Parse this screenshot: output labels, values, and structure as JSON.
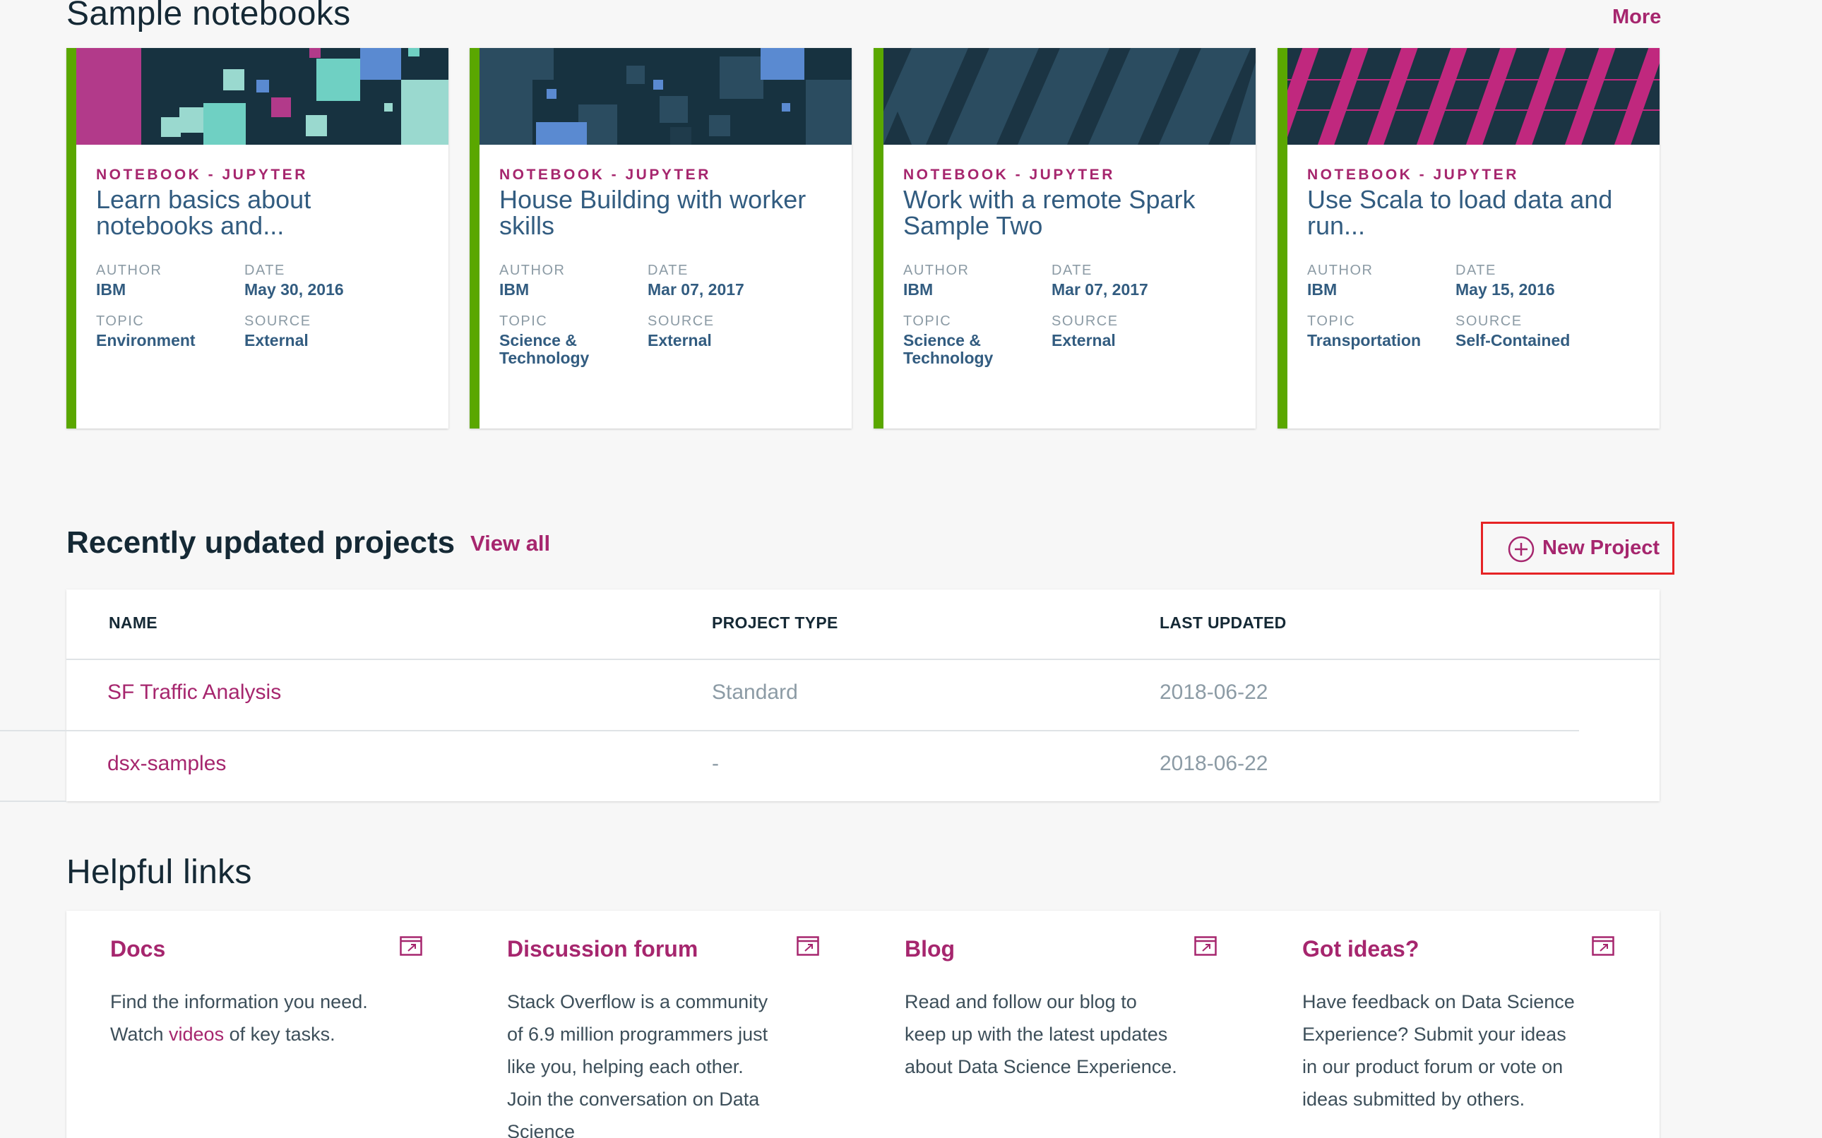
{
  "sample_notebooks": {
    "title": "Sample notebooks",
    "more_label": "More",
    "cards": [
      {
        "type": "NOTEBOOK - JUPYTER",
        "title": "Learn basics about notebooks and...",
        "author_label": "AUTHOR",
        "author": "IBM",
        "date_label": "DATE",
        "date": "May 30, 2016",
        "topic_label": "TOPIC",
        "topic": "Environment",
        "source_label": "SOURCE",
        "source": "External"
      },
      {
        "type": "NOTEBOOK - JUPYTER",
        "title": "House Building with worker skills",
        "author_label": "AUTHOR",
        "author": "IBM",
        "date_label": "DATE",
        "date": "Mar 07, 2017",
        "topic_label": "TOPIC",
        "topic": "Science & Technology",
        "source_label": "SOURCE",
        "source": "External"
      },
      {
        "type": "NOTEBOOK - JUPYTER",
        "title": "Work with a remote Spark Sample Two",
        "author_label": "AUTHOR",
        "author": "IBM",
        "date_label": "DATE",
        "date": "Mar 07, 2017",
        "topic_label": "TOPIC",
        "topic": "Science & Technology",
        "source_label": "SOURCE",
        "source": "External"
      },
      {
        "type": "NOTEBOOK - JUPYTER",
        "title": "Use Scala to load data and run...",
        "author_label": "AUTHOR",
        "author": "IBM",
        "date_label": "DATE",
        "date": "May 15, 2016",
        "topic_label": "TOPIC",
        "topic": "Transportation",
        "source_label": "SOURCE",
        "source": "Self-Contained"
      }
    ]
  },
  "projects": {
    "title": "Recently updated projects",
    "view_all_label": "View all",
    "new_project_label": "New Project",
    "columns": [
      "NAME",
      "PROJECT TYPE",
      "LAST UPDATED"
    ],
    "rows": [
      {
        "name": "SF Traffic Analysis",
        "type": "Standard",
        "updated": "2018-06-22"
      },
      {
        "name": "dsx-samples",
        "type": "-",
        "updated": "2018-06-22"
      }
    ]
  },
  "helpful_links": {
    "title": "Helpful links",
    "items": [
      {
        "title": "Docs",
        "desc_before": "Find the information you need. Watch ",
        "desc_link": "videos",
        "desc_after": " of key tasks."
      },
      {
        "title": "Discussion forum",
        "desc": "Stack Overflow is a community of 6.9 million programmers just like you, helping each other. Join the conversation on Data Science"
      },
      {
        "title": "Blog",
        "desc": "Read and follow our blog to keep up with the latest updates about Data Science Experience."
      },
      {
        "title": "Got ideas?",
        "desc": "Have feedback on Data Science Experience? Submit your ideas in our product forum or vote on ideas submitted by others."
      }
    ]
  },
  "colors": {
    "accent": "#a6266e",
    "card_stripe": "#5aa700",
    "title_blue": "#325c80",
    "highlight_border": "#e62325"
  },
  "icons": [
    "add-circle-icon",
    "external-link-icon"
  ]
}
